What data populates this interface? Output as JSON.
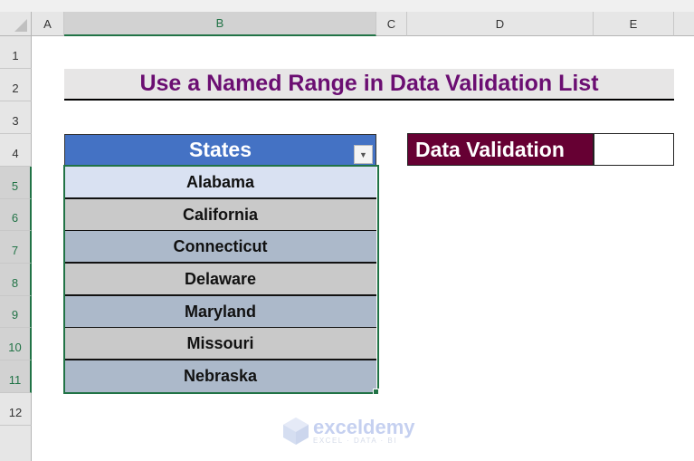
{
  "sheet": {
    "columns": [
      "A",
      "B",
      "C",
      "D",
      "E"
    ],
    "selected_column": "B",
    "rows": [
      "1",
      "2",
      "3",
      "4",
      "5",
      "6",
      "7",
      "8",
      "9",
      "10",
      "11",
      "12"
    ],
    "selected_rows": [
      "5",
      "6",
      "7",
      "8",
      "9",
      "10",
      "11"
    ]
  },
  "title": "Use a Named Range in Data Validation List",
  "table": {
    "header": "States",
    "filter_icon": "dropdown-arrow-icon",
    "items": [
      "Alabama",
      "California",
      "Connecticut",
      "Delaware",
      "Maryland",
      "Missouri",
      "Nebraska"
    ],
    "row_colors": [
      "#d9e1f2",
      "#c9c9c9",
      "#acb9ca",
      "#c9c9c9",
      "#acb9ca",
      "#c9c9c9",
      "#acb9ca"
    ]
  },
  "data_validation": {
    "label": "Data Validation",
    "value": ""
  },
  "watermark": {
    "brand": "exceldemy",
    "tagline": "EXCEL · DATA · BI"
  },
  "colors": {
    "title_text": "#6b0e72",
    "header_bg": "#4472c4",
    "dv_label_bg": "#660033",
    "selection": "#217346"
  }
}
